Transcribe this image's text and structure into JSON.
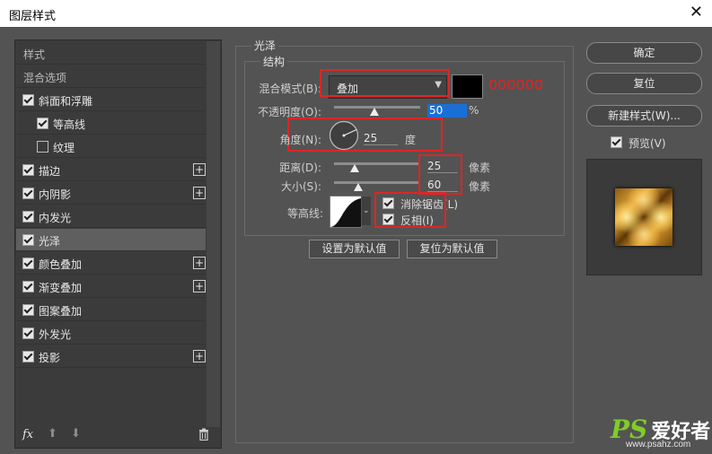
{
  "window": {
    "title": "图层样式",
    "close_icon": "close-icon"
  },
  "sidebar": {
    "items": [
      {
        "label": "样式",
        "type": "header"
      },
      {
        "label": "混合选项",
        "type": "header"
      },
      {
        "label": "斜面和浮雕",
        "checked": true
      },
      {
        "label": "等高线",
        "checked": true,
        "indent": true
      },
      {
        "label": "纹理",
        "checked": false,
        "indent": true
      },
      {
        "label": "描边",
        "checked": true,
        "plus": true
      },
      {
        "label": "内阴影",
        "checked": true,
        "plus": true
      },
      {
        "label": "内发光",
        "checked": true
      },
      {
        "label": "光泽",
        "checked": true,
        "selected": true
      },
      {
        "label": "颜色叠加",
        "checked": true,
        "plus": true
      },
      {
        "label": "渐变叠加",
        "checked": true,
        "plus": true
      },
      {
        "label": "图案叠加",
        "checked": true
      },
      {
        "label": "外发光",
        "checked": true
      },
      {
        "label": "投影",
        "checked": true,
        "plus": true
      }
    ],
    "tools": {
      "fx": "fx",
      "up_icon": "arrow-up-icon",
      "down_icon": "arrow-down-icon",
      "trash_icon": "trash-icon"
    }
  },
  "satin": {
    "section_title": "光泽",
    "group_title": "结构",
    "blend_mode_label": "混合模式(B):",
    "blend_mode_value": "叠加",
    "color_hex_annotation": "000000",
    "swatch_color": "#000000",
    "opacity_label": "不透明度(O):",
    "opacity_value": "50",
    "opacity_unit": "%",
    "angle_label": "角度(N):",
    "angle_value": "25",
    "angle_unit": "度",
    "distance_label": "距离(D):",
    "distance_value": "25",
    "distance_unit": "像素",
    "size_label": "大小(S):",
    "size_value": "60",
    "size_unit": "像素",
    "contour_label": "等高线:",
    "antialias_label": "消除锯齿(L)",
    "antialias_checked": true,
    "invert_label": "反相(I)",
    "invert_checked": true,
    "make_default_label": "设置为默认值",
    "reset_default_label": "复位为默认值"
  },
  "actions": {
    "ok_label": "确定",
    "reset_label": "复位",
    "new_style_label": "新建样式(W)...",
    "preview_label": "预览(V)",
    "preview_checked": true
  },
  "watermark": {
    "ps": "PS",
    "cn": "爱好者",
    "url": "www.psahz.com"
  },
  "colors": {
    "annotation_red": "#e02424",
    "accent_blue": "#1a6fd6"
  }
}
